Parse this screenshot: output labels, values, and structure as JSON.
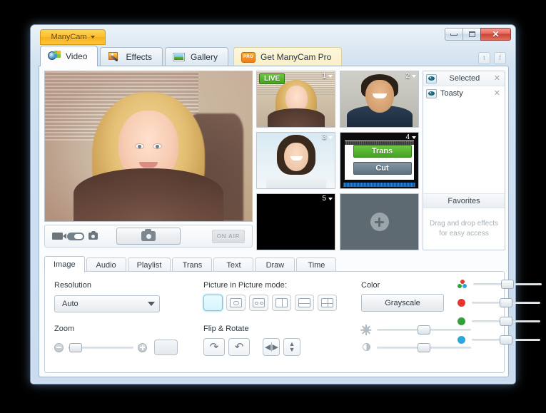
{
  "window": {
    "brand_label": "ManyCam",
    "controls": {
      "minimize": "Minimize",
      "maximize": "Maximize",
      "close": "✕"
    }
  },
  "main_tabs": [
    {
      "label": "Video",
      "icon": "video-icon",
      "active": true
    },
    {
      "label": "Effects",
      "icon": "effects-icon",
      "active": false
    },
    {
      "label": "Gallery",
      "icon": "gallery-icon",
      "active": false
    },
    {
      "label": "Get ManyCam Pro",
      "icon": "pro-badge",
      "active": false,
      "badge": "PRO"
    }
  ],
  "social": [
    {
      "name": "twitter-button",
      "glyph": "t"
    },
    {
      "name": "facebook-button",
      "glyph": "f"
    }
  ],
  "preview_toolbar": {
    "on_air_label": "ON AIR",
    "snapshot_label": "Snapshot"
  },
  "thumbnails": [
    {
      "number": "1",
      "live_badge": "LIVE",
      "kind": "webcam-woman-blonde"
    },
    {
      "number": "2",
      "live_badge": "",
      "kind": "webcam-man"
    },
    {
      "number": "3",
      "live_badge": "",
      "kind": "webcam-woman-brunette"
    },
    {
      "number": "4",
      "live_badge": "",
      "kind": "video-editor",
      "buttons": [
        "Trans",
        "Cut"
      ]
    },
    {
      "number": "5",
      "live_badge": "",
      "kind": "black"
    }
  ],
  "add_source": {
    "label": "+"
  },
  "effects_panel": {
    "selected_title": "Selected",
    "selected_close": "✕",
    "items": [
      {
        "name": "Toasty",
        "close": "✕"
      }
    ],
    "favorites_title": "Favorites",
    "favorites_hint_line1": "Drag and drop effects",
    "favorites_hint_line2": "for easy access"
  },
  "sub_tabs": [
    {
      "label": "Image",
      "active": true
    },
    {
      "label": "Audio",
      "active": false
    },
    {
      "label": "Playlist",
      "active": false
    },
    {
      "label": "Trans",
      "active": false
    },
    {
      "label": "Text",
      "active": false
    },
    {
      "label": "Draw",
      "active": false
    },
    {
      "label": "Time",
      "active": false
    }
  ],
  "image_panel": {
    "resolution_label": "Resolution",
    "resolution_value": "Auto",
    "zoom_label": "Zoom",
    "pip_label": "Picture in Picture mode:",
    "flip_label": "Flip & Rotate",
    "color_label": "Color",
    "grayscale_label": "Grayscale",
    "pip_modes": [
      {
        "name": "pip-mode-full",
        "selected": true
      },
      {
        "name": "pip-mode-inset",
        "selected": false
      },
      {
        "name": "pip-mode-two-inset",
        "selected": false
      },
      {
        "name": "pip-mode-split-v",
        "selected": false
      },
      {
        "name": "pip-mode-split-h",
        "selected": false
      },
      {
        "name": "pip-mode-quad",
        "selected": false
      }
    ],
    "flip_buttons": [
      {
        "name": "rotate-right-button",
        "glyph": "⤻"
      },
      {
        "name": "rotate-left-button",
        "glyph": "⤺"
      },
      {
        "name": "flip-horizontal-button",
        "glyph": "◀▶"
      },
      {
        "name": "flip-vertical-button",
        "glyph": "▲▼"
      }
    ],
    "sliders": [
      {
        "name": "brightness-slider",
        "icon": "sun-icon",
        "value": 50
      },
      {
        "name": "contrast-slider",
        "icon": "contrast-icon",
        "value": 50
      },
      {
        "name": "rgb-slider",
        "icon": "rgb-icon",
        "value": 50
      },
      {
        "name": "red-slider",
        "icon": "red-dot-icon",
        "value": 50,
        "color": "#e8342a"
      },
      {
        "name": "green-slider",
        "icon": "green-dot-icon",
        "value": 50,
        "color": "#2fa33a"
      },
      {
        "name": "blue-slider",
        "icon": "blue-dot-icon",
        "value": 50,
        "color": "#2ba7dd"
      }
    ],
    "zoom_value": 8
  },
  "colors": {
    "brand_yellow": "#fcc02e",
    "live_green": "#43a41f",
    "pip_accent": "#6ec9e8",
    "window_chrome": "#cbdcee"
  }
}
